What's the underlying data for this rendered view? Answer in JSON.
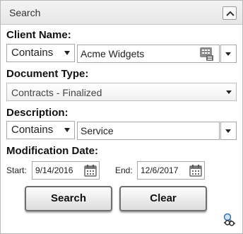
{
  "panel": {
    "title": "Search",
    "collapse_icon": "chevron-up-icon"
  },
  "client_name": {
    "label": "Client Name:",
    "operator": "Contains",
    "value": "Acme Widgets",
    "lookup_icon": "lookup-grid-icon"
  },
  "document_type": {
    "label": "Document Type:",
    "value": "Contracts - Finalized"
  },
  "description": {
    "label": "Description:",
    "operator": "Contains",
    "value": "Service"
  },
  "modification_date": {
    "label": "Modification Date:",
    "start_label": "Start:",
    "start_value": "9/14/2016",
    "end_label": "End:",
    "end_value": "12/6/2017",
    "calendar_icon": "calendar-icon"
  },
  "buttons": {
    "search": "Search",
    "clear": "Clear"
  },
  "footer": {
    "settings_icon": "search-settings-icon"
  }
}
